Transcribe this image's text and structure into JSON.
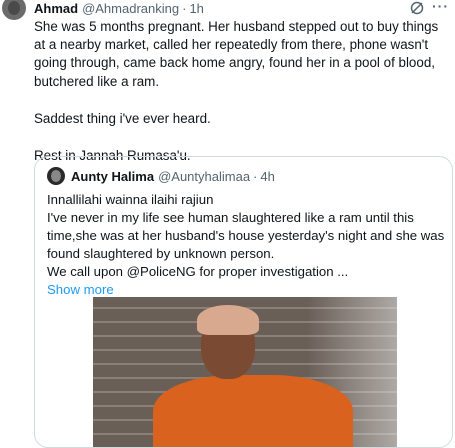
{
  "tweet": {
    "author_name": "Ahmad",
    "author_handle": "@Ahmadranking",
    "separator": "·",
    "time": "1h",
    "paragraphs": [
      "She was 5 months pregnant. Her husband stepped out to buy things at a nearby market, called her repeatedly from there, phone wasn't going through, came back home angry, found her in a pool of blood, butchered like a ram.",
      "Saddest thing i've ever heard.",
      "Rest in Jannah Rumasa'u."
    ]
  },
  "quoted_tweet": {
    "author_name": "Aunty Halima",
    "author_handle": "@Auntyhalimaa",
    "separator": "·",
    "time": "4h",
    "lines": [
      "Innallilahi wainna ilaihi rajiun",
      "I've never in my life see human slaughtered like a ram until this time,she was at her husband's house yesterday's night and she was found slaughtered by unknown person.",
      "We call upon @PoliceNG for proper investigation ..."
    ],
    "show_more": "Show more"
  },
  "icons": {
    "grok": "grok-icon",
    "more": "more-horizontal-icon"
  }
}
